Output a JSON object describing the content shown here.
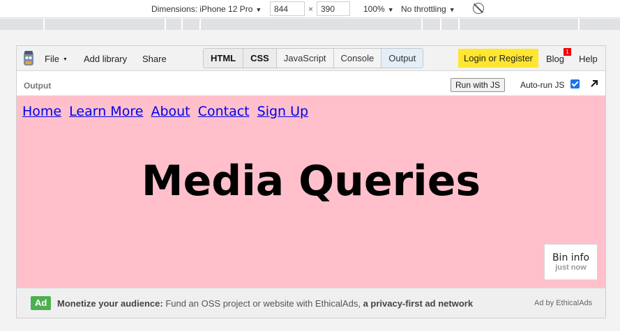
{
  "devtools": {
    "dimensions_label": "Dimensions: iPhone 12 Pro",
    "width": "844",
    "height": "390",
    "times": "×",
    "zoom": "100%",
    "throttling": "No throttling"
  },
  "toolbar": {
    "file": "File",
    "add_library": "Add library",
    "share": "Share",
    "tabs": [
      "HTML",
      "CSS",
      "JavaScript",
      "Console",
      "Output"
    ],
    "login": "Login or Register",
    "blog": "Blog",
    "blog_badge": "1",
    "help": "Help"
  },
  "output_bar": {
    "label": "Output",
    "run_button": "Run with JS",
    "autorun": "Auto-run JS"
  },
  "page": {
    "nav": [
      "Home",
      "Learn More",
      "About",
      "Contact",
      "Sign Up"
    ],
    "headline": "Media Queries",
    "background": "#ffc0cb"
  },
  "bin_info": {
    "title": "Bin info",
    "subtitle": "just now"
  },
  "ad": {
    "badge": "Ad",
    "bold_lead": "Monetize your audience:",
    "text": " Fund an OSS project or website with EthicalAds, ",
    "bold_tail": "a privacy-first ad network",
    "by": "Ad by EthicalAds"
  },
  "colors": {
    "login_bg": "#ffe631",
    "ad_badge": "#4caf50",
    "link": "#0000ee"
  }
}
